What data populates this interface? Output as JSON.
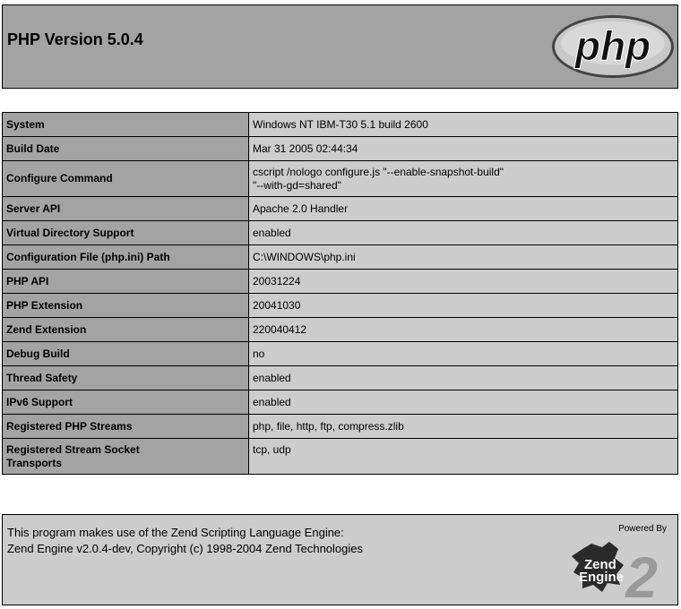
{
  "header": {
    "title": "PHP Version 5.0.4",
    "logo_text": "php"
  },
  "info_rows": [
    {
      "label": "System",
      "value": "Windows NT IBM-T30 5.1 build 2600"
    },
    {
      "label": "Build Date",
      "value": "Mar 31 2005 02:44:34"
    },
    {
      "label": "Configure Command",
      "value_line1": "cscript /nologo configure.js \"--enable-snapshot-build\"",
      "value_line2": "\"--with-gd=shared\""
    },
    {
      "label": "Server API",
      "value": "Apache 2.0 Handler"
    },
    {
      "label": "Virtual Directory Support",
      "value": "enabled"
    },
    {
      "label": "Configuration File (php.ini) Path",
      "value": "C:\\WINDOWS\\php.ini"
    },
    {
      "label": "PHP API",
      "value": "20031224"
    },
    {
      "label": "PHP Extension",
      "value": "20041030"
    },
    {
      "label": "Zend Extension",
      "value": "220040412"
    },
    {
      "label": "Debug Build",
      "value": "no"
    },
    {
      "label": "Thread Safety",
      "value": "enabled"
    },
    {
      "label": "IPv6 Support",
      "value": "enabled"
    },
    {
      "label": "Registered PHP Streams",
      "value": "php, file, http, ftp, compress.zlib"
    },
    {
      "label_line1": "Registered Stream Socket",
      "label_line2": "Transports",
      "value": "tcp, udp"
    }
  ],
  "footer": {
    "line1": "This program makes use of the Zend Scripting Language Engine:",
    "line2": "Zend Engine v2.0.4-dev, Copyright (c) 1998-2004 Zend Technologies",
    "powered_by": "Powered By",
    "zend_logo_line1": "Zend",
    "zend_logo_line2": "Engine",
    "zend_logo_version": "2"
  },
  "colors": {
    "header_bg": "#a3a3a3",
    "label_cell_bg": "#a3a3a3",
    "value_cell_bg": "#cccccc",
    "footer_bg": "#cccccc"
  }
}
